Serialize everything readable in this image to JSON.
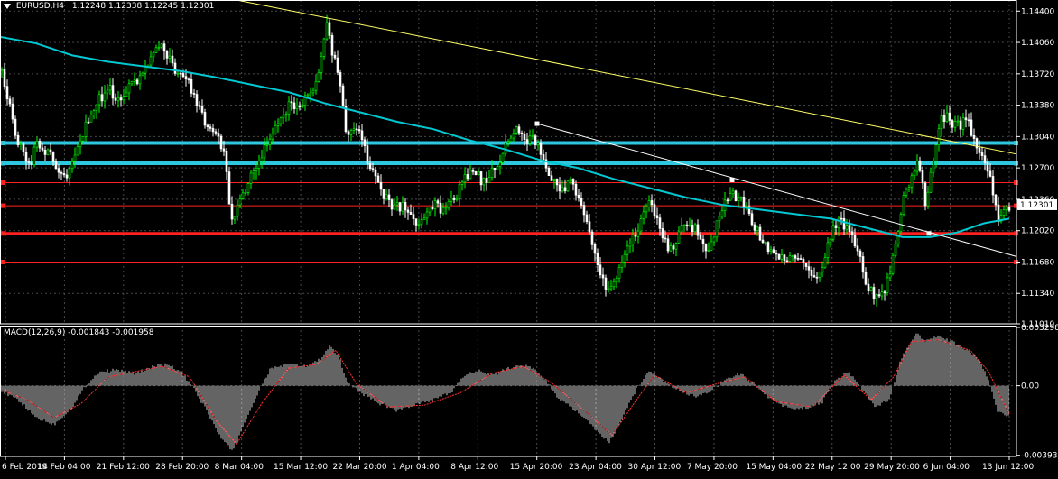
{
  "header": {
    "symbol": "EURUSD,H4",
    "ohlc": "1.12248 1.12338 1.12245 1.12301"
  },
  "macd_header": {
    "label": "MACD(12,26,9) -0.001843 -0.001958"
  },
  "colors": {
    "background": "#000000",
    "grid": "#4a4a4a",
    "bull_candle": "#00ff00",
    "bear_candle": "#ffffff",
    "chart_frame": "#ffffff",
    "moving_average": "#00c8d2",
    "trendline_main": "#ffff66",
    "trendline_secondary": "#ffffff",
    "support_cyan": "#2fc6e0",
    "support_red": "#ff2020",
    "macd_hist": "#c8c8c8",
    "macd_signal": "#ff3030",
    "price_tag_bg": "#ffffff",
    "price_tag_text": "#000000"
  },
  "chart_data": [
    {
      "type": "candlestick",
      "symbol": "EURUSD",
      "timeframe": "H4",
      "ylim": [
        1.1101,
        1.1452
      ],
      "price_axis_ticks": [
        "1.14400",
        "1.14060",
        "1.13720",
        "1.13380",
        "1.13040",
        "1.12700",
        "1.12360",
        "1.12020",
        "1.11680",
        "1.11340",
        "1.11010"
      ],
      "current_price": "1.12301",
      "time_axis_ticks": [
        "6 Feb 2019",
        "14 Feb 04:00",
        "21 Feb 12:00",
        "28 Feb 20:00",
        "8 Mar 04:00",
        "15 Mar 12:00",
        "22 Mar 20:00",
        "1 Apr 04:00",
        "8 Apr 12:00",
        "15 Apr 20:00",
        "23 Apr 04:00",
        "30 Apr 12:00",
        "7 May 20:00",
        "15 May 04:00",
        "22 May 12:00",
        "29 May 20:00",
        "6 Jun 04:00",
        "13 Jun 12:00"
      ],
      "close_path": [
        [
          0,
          1.1375
        ],
        [
          8,
          1.1345
        ],
        [
          16,
          1.13
        ],
        [
          24,
          1.1292
        ],
        [
          32,
          1.127
        ],
        [
          40,
          1.1298
        ],
        [
          48,
          1.129
        ],
        [
          56,
          1.1282
        ],
        [
          64,
          1.127
        ],
        [
          72,
          1.1262
        ],
        [
          80,
          1.1285
        ],
        [
          88,
          1.13
        ],
        [
          96,
          1.1322
        ],
        [
          104,
          1.1338
        ],
        [
          112,
          1.1348
        ],
        [
          120,
          1.1358
        ],
        [
          128,
          1.1345
        ],
        [
          136,
          1.1352
        ],
        [
          144,
          1.136
        ],
        [
          152,
          1.1368
        ],
        [
          160,
          1.1375
        ],
        [
          168,
          1.1392
        ],
        [
          176,
          1.14
        ],
        [
          184,
          1.1395
        ],
        [
          192,
          1.1378
        ],
        [
          200,
          1.1372
        ],
        [
          208,
          1.136
        ],
        [
          216,
          1.1345
        ],
        [
          224,
          1.1325
        ],
        [
          232,
          1.131
        ],
        [
          240,
          1.1305
        ],
        [
          248,
          1.128
        ],
        [
          256,
          1.121
        ],
        [
          264,
          1.1235
        ],
        [
          272,
          1.1248
        ],
        [
          280,
          1.1268
        ],
        [
          288,
          1.128
        ],
        [
          296,
          1.13
        ],
        [
          304,
          1.1315
        ],
        [
          312,
          1.1328
        ],
        [
          320,
          1.1338
        ],
        [
          328,
          1.1335
        ],
        [
          336,
          1.1342
        ],
        [
          344,
          1.1348
        ],
        [
          352,
          1.137
        ],
        [
          360,
          1.1428
        ],
        [
          368,
          1.1392
        ],
        [
          376,
          1.136
        ],
        [
          384,
          1.13
        ],
        [
          392,
          1.1318
        ],
        [
          400,
          1.1305
        ],
        [
          408,
          1.1272
        ],
        [
          416,
          1.1258
        ],
        [
          424,
          1.1242
        ],
        [
          432,
          1.1228
        ],
        [
          440,
          1.123
        ],
        [
          448,
          1.1225
        ],
        [
          456,
          1.1215
        ],
        [
          464,
          1.1206
        ],
        [
          472,
          1.1218
        ],
        [
          480,
          1.1232
        ],
        [
          488,
          1.1222
        ],
        [
          496,
          1.1228
        ],
        [
          504,
          1.1238
        ],
        [
          512,
          1.1255
        ],
        [
          520,
          1.1268
        ],
        [
          528,
          1.1262
        ],
        [
          536,
          1.1252
        ],
        [
          544,
          1.1268
        ],
        [
          552,
          1.1272
        ],
        [
          560,
          1.1296
        ],
        [
          568,
          1.1312
        ],
        [
          576,
          1.1305
        ],
        [
          584,
          1.13
        ],
        [
          592,
          1.1298
        ],
        [
          600,
          1.1282
        ],
        [
          608,
          1.1262
        ],
        [
          616,
          1.1252
        ],
        [
          624,
          1.1248
        ],
        [
          632,
          1.1255
        ],
        [
          640,
          1.124
        ],
        [
          648,
          1.1215
        ],
        [
          656,
          1.118
        ],
        [
          664,
          1.1152
        ],
        [
          672,
          1.1138
        ],
        [
          680,
          1.1148
        ],
        [
          688,
          1.117
        ],
        [
          696,
          1.1185
        ],
        [
          704,
          1.12
        ],
        [
          712,
          1.1225
        ],
        [
          720,
          1.1232
        ],
        [
          728,
          1.1212
        ],
        [
          736,
          1.1188
        ],
        [
          744,
          1.1182
        ],
        [
          752,
          1.12
        ],
        [
          760,
          1.1212
        ],
        [
          768,
          1.1205
        ],
        [
          776,
          1.119
        ],
        [
          784,
          1.1182
        ],
        [
          792,
          1.1205
        ],
        [
          800,
          1.1225
        ],
        [
          808,
          1.1242
        ],
        [
          816,
          1.1238
        ],
        [
          824,
          1.1228
        ],
        [
          832,
          1.1212
        ],
        [
          840,
          1.1198
        ],
        [
          848,
          1.1182
        ],
        [
          856,
          1.1178
        ],
        [
          864,
          1.117
        ],
        [
          872,
          1.1168
        ],
        [
          880,
          1.1175
        ],
        [
          888,
          1.117
        ],
        [
          896,
          1.116
        ],
        [
          904,
          1.1152
        ],
        [
          912,
          1.1168
        ],
        [
          920,
          1.12
        ],
        [
          928,
          1.1215
        ],
        [
          936,
          1.1205
        ],
        [
          944,
          1.1195
        ],
        [
          952,
          1.1172
        ],
        [
          960,
          1.114
        ],
        [
          968,
          1.1132
        ],
        [
          976,
          1.1135
        ],
        [
          984,
          1.115
        ],
        [
          992,
          1.1195
        ],
        [
          1000,
          1.1235
        ],
        [
          1008,
          1.1258
        ],
        [
          1016,
          1.1282
        ],
        [
          1024,
          1.1232
        ],
        [
          1032,
          1.127
        ],
        [
          1040,
          1.132
        ],
        [
          1048,
          1.133
        ],
        [
          1056,
          1.1315
        ],
        [
          1064,
          1.1318
        ],
        [
          1072,
          1.1322
        ],
        [
          1080,
          1.1292
        ],
        [
          1088,
          1.1282
        ],
        [
          1096,
          1.1262
        ],
        [
          1104,
          1.1215
        ],
        [
          1112,
          1.122
        ],
        [
          1118,
          1.123
        ]
      ],
      "moving_average_path": [
        [
          0,
          1.1412
        ],
        [
          40,
          1.1405
        ],
        [
          80,
          1.1392
        ],
        [
          120,
          1.1385
        ],
        [
          160,
          1.138
        ],
        [
          200,
          1.1375
        ],
        [
          240,
          1.1368
        ],
        [
          280,
          1.136
        ],
        [
          320,
          1.1352
        ],
        [
          360,
          1.134
        ],
        [
          400,
          1.133
        ],
        [
          440,
          1.132
        ],
        [
          480,
          1.1312
        ],
        [
          520,
          1.13
        ],
        [
          560,
          1.129
        ],
        [
          600,
          1.1278
        ],
        [
          640,
          1.127
        ],
        [
          680,
          1.1258
        ],
        [
          720,
          1.1248
        ],
        [
          760,
          1.1238
        ],
        [
          800,
          1.123
        ],
        [
          840,
          1.1225
        ],
        [
          880,
          1.122
        ],
        [
          920,
          1.1215
        ],
        [
          960,
          1.1205
        ],
        [
          1000,
          1.1195
        ],
        [
          1030,
          1.1195
        ],
        [
          1060,
          1.12
        ],
        [
          1090,
          1.121
        ],
        [
          1118,
          1.1215
        ]
      ],
      "horizontal_levels": [
        {
          "price": 1.1297,
          "color": "cyan",
          "width": 4
        },
        {
          "price": 1.1275,
          "color": "cyan",
          "width": 4
        },
        {
          "price": 1.1254,
          "color": "red",
          "width": 1
        },
        {
          "price": 1.1229,
          "color": "red",
          "width": 1
        },
        {
          "price": 1.1199,
          "color": "red",
          "width": 3
        },
        {
          "price": 1.1168,
          "color": "red",
          "width": 1
        }
      ],
      "trendlines": [
        {
          "color": "yellow",
          "from": [
            262,
            1.1452
          ],
          "to": [
            1126,
            1.1285
          ]
        },
        {
          "color": "white",
          "from": [
            595,
            1.1318
          ],
          "to": [
            1126,
            1.1174
          ],
          "markers": [
            [
              595,
              1.1318
            ],
            [
              811,
              1.1257
            ],
            [
              1029,
              1.1199
            ]
          ]
        }
      ]
    },
    {
      "type": "macd",
      "title": "MACD(12,26,9) -0.001843 -0.001958",
      "ylim": [
        -0.004,
        0.0034
      ],
      "axis_ticks": [
        "0.003298",
        "0.00",
        "-0.003934"
      ],
      "histogram_path": [
        [
          0,
          -0.0003
        ],
        [
          20,
          -0.0008
        ],
        [
          40,
          -0.0018
        ],
        [
          60,
          -0.0022
        ],
        [
          80,
          -0.0012
        ],
        [
          95,
          0.0
        ],
        [
          110,
          0.0008
        ],
        [
          130,
          0.0009
        ],
        [
          150,
          0.0007
        ],
        [
          170,
          0.0011
        ],
        [
          185,
          0.0012
        ],
        [
          200,
          0.0008
        ],
        [
          215,
          -0.0002
        ],
        [
          230,
          -0.0015
        ],
        [
          245,
          -0.003
        ],
        [
          258,
          -0.0037
        ],
        [
          270,
          -0.0022
        ],
        [
          285,
          -0.0005
        ],
        [
          300,
          0.001
        ],
        [
          320,
          0.0012
        ],
        [
          340,
          0.0011
        ],
        [
          355,
          0.0015
        ],
        [
          365,
          0.0022
        ],
        [
          375,
          0.0017
        ],
        [
          385,
          0.0002
        ],
        [
          400,
          -0.0004
        ],
        [
          420,
          -0.001
        ],
        [
          440,
          -0.0014
        ],
        [
          460,
          -0.0011
        ],
        [
          480,
          -0.0008
        ],
        [
          500,
          -0.0004
        ],
        [
          515,
          0.0006
        ],
        [
          530,
          0.0009
        ],
        [
          545,
          0.0006
        ],
        [
          560,
          0.0009
        ],
        [
          575,
          0.0012
        ],
        [
          590,
          0.001
        ],
        [
          605,
          0.0003
        ],
        [
          620,
          -0.0008
        ],
        [
          640,
          -0.0015
        ],
        [
          660,
          -0.0025
        ],
        [
          675,
          -0.0032
        ],
        [
          690,
          -0.0018
        ],
        [
          705,
          -0.0002
        ],
        [
          720,
          0.0009
        ],
        [
          735,
          0.0002
        ],
        [
          750,
          -0.0002
        ],
        [
          770,
          -0.0006
        ],
        [
          790,
          -0.0002
        ],
        [
          805,
          0.0004
        ],
        [
          820,
          0.0007
        ],
        [
          835,
          0.0001
        ],
        [
          850,
          -0.0006
        ],
        [
          870,
          -0.0012
        ],
        [
          890,
          -0.0013
        ],
        [
          910,
          -0.001
        ],
        [
          925,
          0.0003
        ],
        [
          940,
          0.0008
        ],
        [
          955,
          -0.0002
        ],
        [
          970,
          -0.0012
        ],
        [
          985,
          -0.0008
        ],
        [
          1000,
          0.0018
        ],
        [
          1015,
          0.003
        ],
        [
          1025,
          0.0025
        ],
        [
          1040,
          0.0028
        ],
        [
          1055,
          0.0025
        ],
        [
          1070,
          0.002
        ],
        [
          1085,
          0.0015
        ],
        [
          1095,
          0.0003
        ],
        [
          1105,
          -0.0015
        ],
        [
          1118,
          -0.0018
        ]
      ],
      "signal_path": [
        [
          0,
          -0.0002
        ],
        [
          30,
          -0.0008
        ],
        [
          60,
          -0.0018
        ],
        [
          90,
          -0.001
        ],
        [
          120,
          0.0005
        ],
        [
          150,
          0.0008
        ],
        [
          180,
          0.0011
        ],
        [
          210,
          0.0005
        ],
        [
          240,
          -0.002
        ],
        [
          262,
          -0.0033
        ],
        [
          290,
          -0.001
        ],
        [
          320,
          0.001
        ],
        [
          350,
          0.0012
        ],
        [
          372,
          0.002
        ],
        [
          395,
          0.0001
        ],
        [
          430,
          -0.0012
        ],
        [
          470,
          -0.0011
        ],
        [
          510,
          -0.0004
        ],
        [
          545,
          0.0007
        ],
        [
          580,
          0.0011
        ],
        [
          610,
          0.0002
        ],
        [
          645,
          -0.0013
        ],
        [
          678,
          -0.0028
        ],
        [
          705,
          -0.0008
        ],
        [
          725,
          0.0006
        ],
        [
          760,
          -0.0004
        ],
        [
          800,
          0.0002
        ],
        [
          825,
          0.0005
        ],
        [
          860,
          -0.0009
        ],
        [
          900,
          -0.0012
        ],
        [
          935,
          0.0006
        ],
        [
          965,
          -0.0008
        ],
        [
          990,
          0.0005
        ],
        [
          1010,
          0.0025
        ],
        [
          1040,
          0.0026
        ],
        [
          1075,
          0.002
        ],
        [
          1095,
          0.0008
        ],
        [
          1118,
          -0.0016
        ]
      ]
    }
  ]
}
